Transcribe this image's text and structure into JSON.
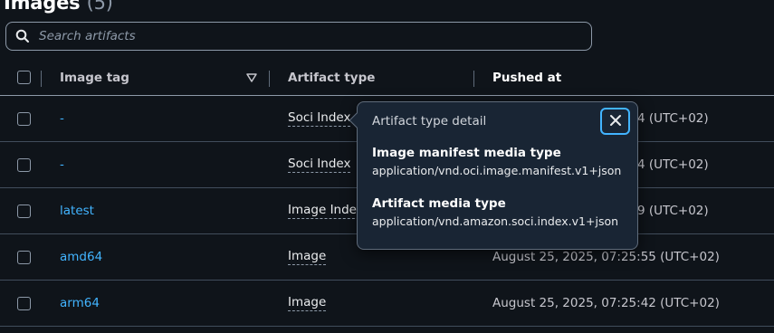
{
  "page": {
    "title": "Images",
    "count": "(5)"
  },
  "search": {
    "placeholder": "Search artifacts",
    "icon": "search-icon"
  },
  "table": {
    "columns": {
      "image_tag": "Image tag",
      "artifact_type": "Artifact type",
      "pushed_at": "Pushed at"
    },
    "sort_icon": "sort-descending-icon",
    "rows": [
      {
        "tag": "-",
        "artifact_type": "Soci Index",
        "pushed_at": "4 (UTC+02)"
      },
      {
        "tag": "-",
        "artifact_type": "Soci Index",
        "pushed_at": "4 (UTC+02)"
      },
      {
        "tag": "latest",
        "artifact_type": "Image Index",
        "pushed_at": "9 (UTC+02)"
      },
      {
        "tag": "amd64",
        "artifact_type": "Image",
        "pushed_at": "August 25, 2025, 07:25:55 (UTC+02)"
      },
      {
        "tag": "arm64",
        "artifact_type": "Image",
        "pushed_at": "August 25, 2025, 07:25:42 (UTC+02)"
      }
    ]
  },
  "popover": {
    "title": "Artifact type detail",
    "close_icon": "close-icon",
    "manifest_label": "Image manifest media type",
    "manifest_value": "application/vnd.oci.image.manifest.v1+json",
    "artifact_label": "Artifact media type",
    "artifact_value": "application/vnd.amazon.soci.index.v1+json"
  },
  "colors": {
    "background": "#0f141a",
    "link": "#42b4ff",
    "border": "#414d5c",
    "popover_bg": "#192534"
  }
}
